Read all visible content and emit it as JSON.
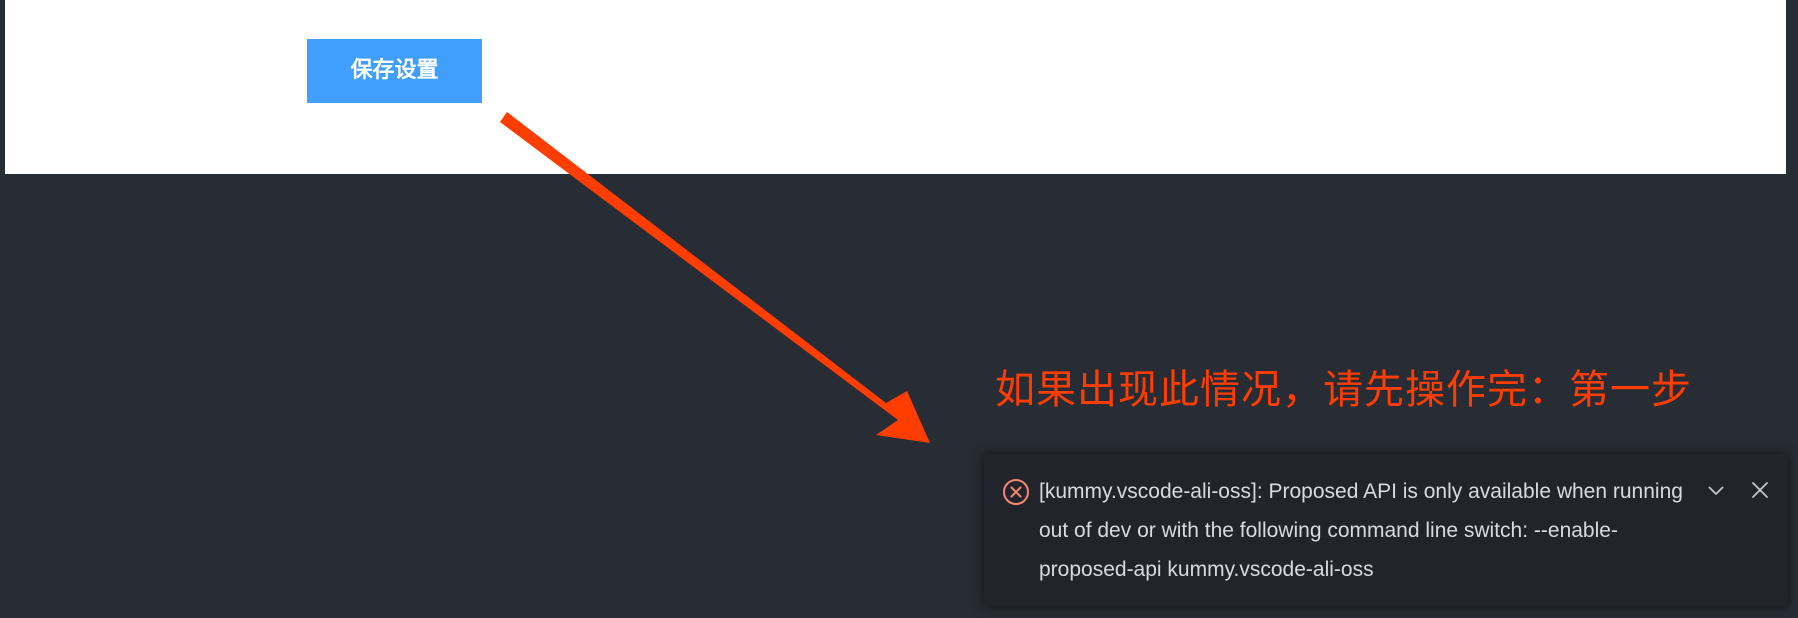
{
  "settings": {
    "save_label": "保存设置"
  },
  "annotation": {
    "text": "如果出现此情况，请先操作完：第一步",
    "color": "#ff3d00"
  },
  "notification": {
    "severity": "error",
    "icon": "error-icon",
    "message": "[kummy.vscode-ali-oss]: Proposed API is only available when running out of dev or with the following command line switch: --enable-proposed-api kummy.vscode-ali-oss",
    "actions": [
      {
        "name": "expand",
        "icon": "chevron-down-icon"
      },
      {
        "name": "close",
        "icon": "close-icon"
      }
    ]
  },
  "colors": {
    "background": "#282c34",
    "panel": "#ffffff",
    "accent": "#409eff",
    "error": "#f48771",
    "notification_bg": "#21252b"
  }
}
